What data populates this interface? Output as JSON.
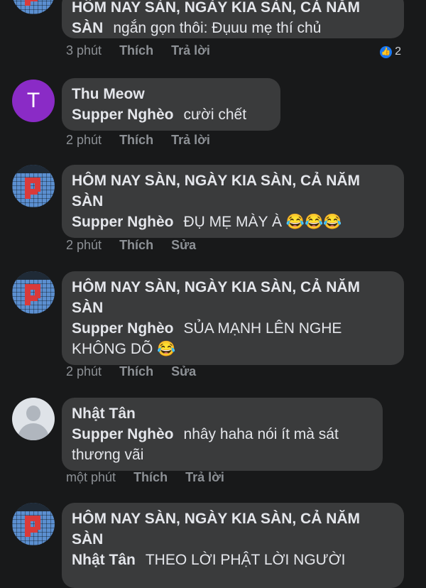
{
  "comments": [
    {
      "group_name": "HÔM NAY SÀN, NGÀY KIA SÀN, CẢ NĂM SÀN",
      "tag": "",
      "tag_prefix": "SÀN",
      "text": "ngắn gọn thôi: Đụuu mẹ thí chủ",
      "time": "3 phút",
      "like": "Thích",
      "reply": "Trả lời",
      "reaction_count": "2"
    },
    {
      "avatar_letter": "T",
      "name": "Thu Meow",
      "tag": "Supper Nghèo",
      "text": "cười chết",
      "time": "2 phút",
      "like": "Thích",
      "reply": "Trả lời"
    },
    {
      "name": "HÔM NAY SÀN, NGÀY KIA SÀN, CẢ NĂM SÀN",
      "tag": "Supper Nghèo",
      "text": "ĐỤ MẸ MÀY À 😂😂😂",
      "time": "2 phút",
      "like": "Thích",
      "reply": "Sửa"
    },
    {
      "name": "HÔM NAY SÀN, NGÀY KIA SÀN, CẢ NĂM SÀN",
      "tag": "Supper Nghèo",
      "text": "SỦA MẠNH LÊN NGHE KHÔNG DÕ 😂",
      "time": "2 phút",
      "like": "Thích",
      "reply": "Sửa"
    },
    {
      "name": "Nhật Tân",
      "tag": "Supper Nghèo",
      "text": "nhây haha nói ít mà sát thương vãi",
      "time": "một phút",
      "like": "Thích",
      "reply": "Trả lời"
    },
    {
      "name": "HÔM NAY SÀN, NGÀY KIA SÀN, CẢ NĂM SÀN",
      "tag": "Nhật Tân",
      "text": "THEO LỜI PHẬT LỜI NGƯỜI"
    }
  ],
  "colors": {
    "background": "#18191a",
    "bubble": "#3a3b3c",
    "like_blue": "#1877f2",
    "avatar_purple": "#8a2bc6"
  }
}
